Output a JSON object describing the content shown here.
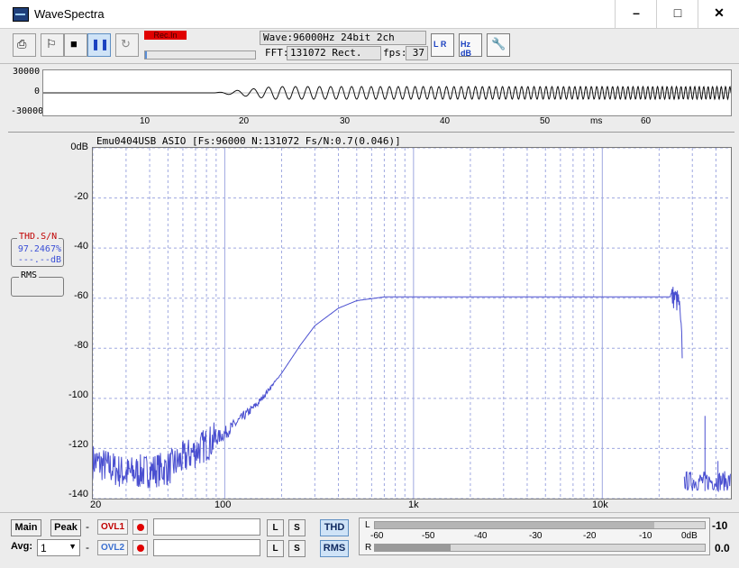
{
  "window": {
    "title": "WaveSpectra",
    "minimize_glyph": "–",
    "maximize_glyph": "□",
    "close_glyph": "✕"
  },
  "toolbar": {
    "buttons": [
      {
        "name": "open-icon",
        "glyph": "⎙"
      },
      {
        "name": "flag-icon",
        "glyph": "⚐"
      },
      {
        "name": "stop-icon",
        "glyph": "■"
      },
      {
        "name": "pause-icon",
        "glyph": "❚❚"
      },
      {
        "name": "refresh-icon",
        "glyph": "↻"
      }
    ],
    "rec_indicator": "Rec.In",
    "progress_fraction": 0.02,
    "wave_info": "Wave:96000Hz 24bit 2ch",
    "fft_label": "FFT:",
    "fft_value": "131072 Rect.",
    "fps_label": "fps:",
    "fps_value": "37",
    "icon_buttons": [
      {
        "name": "lr-channel-icon",
        "text": "L R"
      },
      {
        "name": "hz-db-axis-icon",
        "text": "Hz dB"
      },
      {
        "name": "settings-wrench-icon",
        "text": "🔧"
      }
    ]
  },
  "waveform": {
    "y_ticks": [
      "30000",
      "0",
      "-30000"
    ],
    "x_ticks": [
      "10",
      "20",
      "30",
      "40",
      "50",
      "60"
    ],
    "x_unit": "ms"
  },
  "spectrum": {
    "header": "Emu0404USB ASIO  [Fs:96000 N:131072 Fs/N:0.7(0.046)]",
    "y_ticks": [
      "0dB",
      "-20",
      "-40",
      "-60",
      "-80",
      "-100",
      "-120",
      "-140"
    ],
    "x_ticks": [
      "20",
      "100",
      "1k",
      "10k"
    ],
    "colors": {
      "trace": "#4a4fd0",
      "grid": "#9fa8e0"
    }
  },
  "chart_data": {
    "type": "line",
    "title": "",
    "xlabel": "",
    "ylabel": "",
    "x_scale": "log",
    "xlim": [
      20,
      48000
    ],
    "ylim": [
      -140,
      0
    ],
    "grid": true,
    "series": [
      {
        "x": [
          20,
          30,
          50,
          70,
          100,
          150,
          200,
          250,
          300,
          400,
          500,
          700,
          1000,
          2000,
          5000,
          10000,
          20000,
          24000,
          25500,
          26500,
          27200,
          30000,
          40000,
          48000
        ],
        "values": [
          -125,
          -130,
          -128,
          -121,
          -114,
          -102,
          -90,
          -79,
          -71,
          -64,
          -61,
          -59.5,
          -59.5,
          -59.5,
          -59.5,
          -59.5,
          -59.5,
          -59.5,
          -62,
          -80,
          -136,
          -137,
          -137,
          -137
        ]
      }
    ]
  },
  "thd_group": {
    "title": "THD.S/N",
    "value": "97.2467%",
    "db": "---.--dB"
  },
  "rms_group": {
    "title": "RMS"
  },
  "bottom": {
    "main_label": "Main",
    "peak_label": "Peak",
    "dash1": "-",
    "ovl1": "OVL1",
    "ovl2": "OVL2",
    "l_label": "L",
    "s_label": "S",
    "thd_button": "THD",
    "rms_button": "RMS",
    "avg_label": "Avg:",
    "avg_value": "1",
    "dash2": "-"
  },
  "meter": {
    "ticks": [
      "-60",
      "-50",
      "-40",
      "-30",
      "-20",
      "-10",
      "0dB"
    ],
    "left_label": "L",
    "right_label": "R",
    "left_level_db": -10,
    "right_level_db": -50,
    "left_readout": "-10",
    "right_readout": "0.0"
  }
}
